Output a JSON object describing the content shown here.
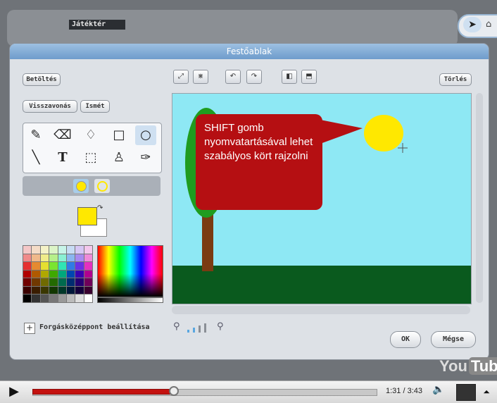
{
  "stage": {
    "label": "Játéktér"
  },
  "dialog": {
    "title": "Festőablak",
    "buttons": {
      "load": "Betöltés",
      "clear": "Törlés",
      "undo": "Visszavonás",
      "redo": "Ismét",
      "ok": "OK",
      "cancel": "Mégse"
    },
    "rotation_center_label": "Forgásközéppont beállítása",
    "callout_text": "SHIFT gomb nyomvatartásával lehet szabályos kört rajzolni",
    "selected_tool": "ellipse-tool",
    "foreground_color": "#ffe800",
    "background_color": "#ffffff"
  },
  "player": {
    "time": "1:31 / 3:43",
    "progress_fraction": 0.41,
    "logo_you": "You",
    "logo_tube": "Tube"
  }
}
